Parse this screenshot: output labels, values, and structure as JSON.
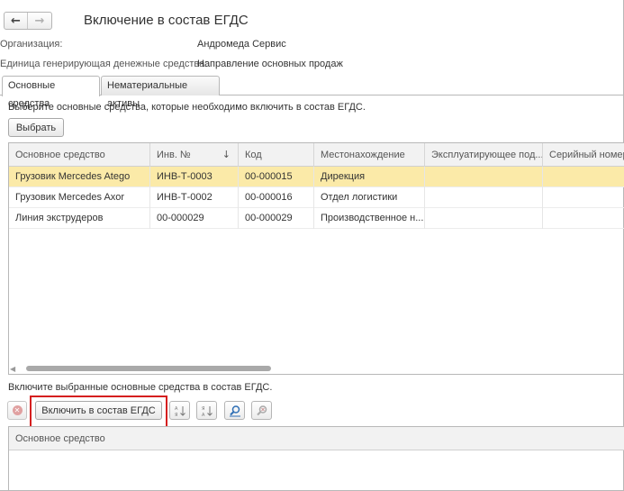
{
  "header": {
    "title": "Включение в состав ЕГДС",
    "back_icon": "←",
    "forward_icon": "→"
  },
  "info": {
    "org_label": "Организация:",
    "org_value": "Андромеда Сервис",
    "unit_label": "Единица генерирующая денежные средства:",
    "unit_value": "Направление основных продаж"
  },
  "tabs": [
    {
      "label": "Основные средства",
      "active": true
    },
    {
      "label": "Нематериальные активы",
      "active": false
    }
  ],
  "top_section": {
    "hint": "Выберите основные средства, которые необходимо включить в состав ЕГДС.",
    "select_button": "Выбрать"
  },
  "assets_table": {
    "columns": [
      "Основное средство",
      "Инв. №",
      "Код",
      "Местонахождение",
      "Эксплуатирующее под...",
      "Серийный номер"
    ],
    "sort_indicator": "↓",
    "rows": [
      {
        "name": "Грузовик Mercedes Atego",
        "inv": "ИНВ-Т-0003",
        "code": "00-000015",
        "location": "Дирекция",
        "operator": "",
        "serial": ""
      },
      {
        "name": "Грузовик Mercedes Axor",
        "inv": "ИНВ-Т-0002",
        "code": "00-000016",
        "location": "Отдел логистики",
        "operator": "",
        "serial": ""
      },
      {
        "name": "Линия экструдеров",
        "inv": "00-000029",
        "code": "00-000029",
        "location": "Производственное н...",
        "operator": "",
        "serial": ""
      }
    ],
    "selected_row": 0
  },
  "bottom_section": {
    "hint": "Включите выбранные основные средства в состав ЕГДС.",
    "include_button": "Включить в состав ЕГДС",
    "table_column": "Основное средство"
  },
  "colors": {
    "selected_row": "#fbeaa8",
    "highlight_frame": "#d51f1f"
  }
}
